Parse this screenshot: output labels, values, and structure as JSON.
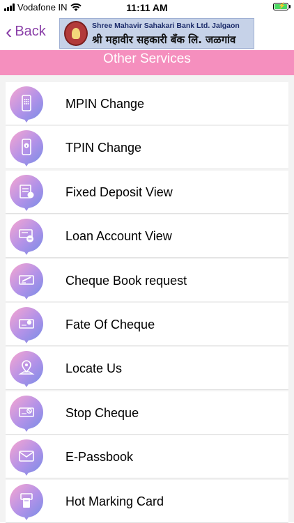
{
  "status_bar": {
    "carrier": "Vodafone IN",
    "time": "11:11 AM",
    "battery_level": 1.0,
    "battery_color": "#4cd964"
  },
  "nav": {
    "back_label": "Back",
    "bank_name_en": "Shree Mahavir Sahakari Bank Ltd. Jalgaon",
    "bank_name_mr": "श्री महावीर सहकारी बँक लि. जळगांव"
  },
  "page_title": "Other Services",
  "colors": {
    "accent": "#8a3fa8",
    "title_bar": "#f58fbe",
    "icon_gradient_start": "#f7a6d0",
    "icon_gradient_end": "#7b8de6"
  },
  "services": [
    {
      "label": "MPIN Change",
      "icon": "phone-keypad-icon"
    },
    {
      "label": "TPIN Change",
      "icon": "phone-lock-icon"
    },
    {
      "label": "Fixed Deposit View",
      "icon": "fixed-deposit-icon"
    },
    {
      "label": "Loan Account View",
      "icon": "loan-account-icon"
    },
    {
      "label": "Cheque Book request",
      "icon": "cheque-book-icon"
    },
    {
      "label": "Fate Of Cheque",
      "icon": "cheque-status-icon"
    },
    {
      "label": "Locate Us",
      "icon": "location-pin-icon"
    },
    {
      "label": "Stop Cheque",
      "icon": "stop-cheque-icon"
    },
    {
      "label": "E-Passbook",
      "icon": "envelope-icon"
    },
    {
      "label": "Hot Marking Card",
      "icon": "card-block-icon"
    }
  ]
}
